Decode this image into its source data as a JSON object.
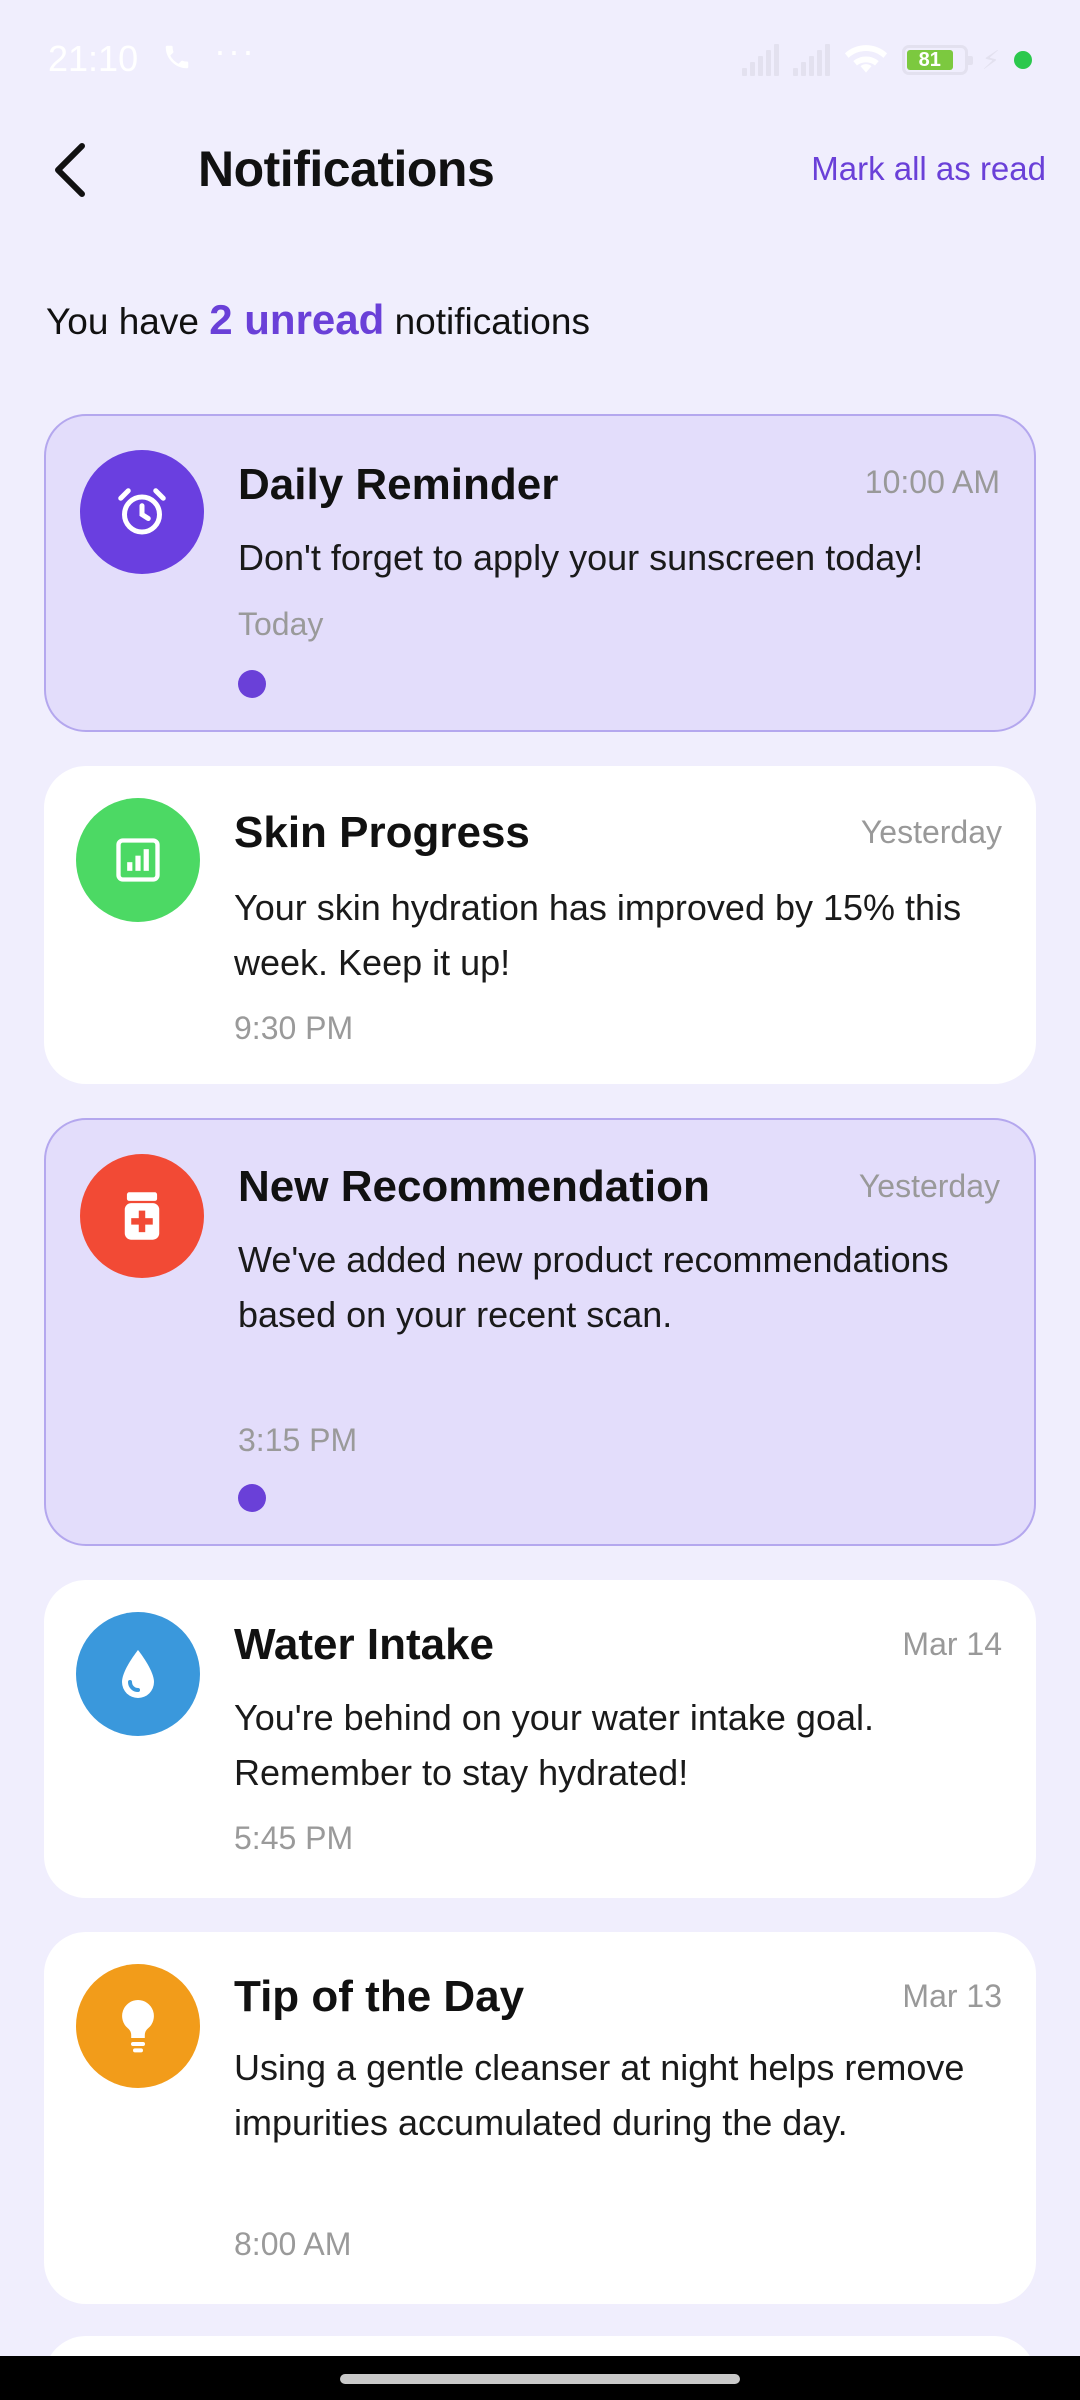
{
  "status": {
    "time": "21:10",
    "dots": "···",
    "battery": "81"
  },
  "header": {
    "title": "Notifications",
    "mark_all": "Mark all as read"
  },
  "summary": {
    "prefix": "You have",
    "unread": "2 unread",
    "suffix": "notifications"
  },
  "notifications": [
    {
      "title": "Daily Reminder",
      "when": "10:00 AM",
      "body": "Don't forget to apply your sunscreen today!",
      "sub": "Today",
      "unread": true,
      "icon": "alarm-clock-icon",
      "color": "#6a3fe0"
    },
    {
      "title": "Skin Progress",
      "when": "Yesterday",
      "body": "Your skin hydration has improved by 15% this week. Keep it up!",
      "sub": "9:30 PM",
      "unread": false,
      "icon": "chart-icon",
      "color": "#4cd964"
    },
    {
      "title": "New Recommendation",
      "when": "Yesterday",
      "body": "We've added new product recommendations based on your recent scan.",
      "sub": "3:15 PM",
      "unread": true,
      "icon": "medical-bottle-icon",
      "color": "#f24a35"
    },
    {
      "title": "Water Intake",
      "when": "Mar 14",
      "body": "You're behind on your water intake goal. Remember to stay hydrated!",
      "sub": "5:45 PM",
      "unread": false,
      "icon": "water-drop-icon",
      "color": "#3a98dc"
    },
    {
      "title": "Tip of the Day",
      "when": "Mar 13",
      "body": "Using a gentle cleanser at night helps remove impurities accumulated during the day.",
      "sub": "8:00 AM",
      "unread": false,
      "icon": "lightbulb-icon",
      "color": "#f29c1a"
    }
  ]
}
